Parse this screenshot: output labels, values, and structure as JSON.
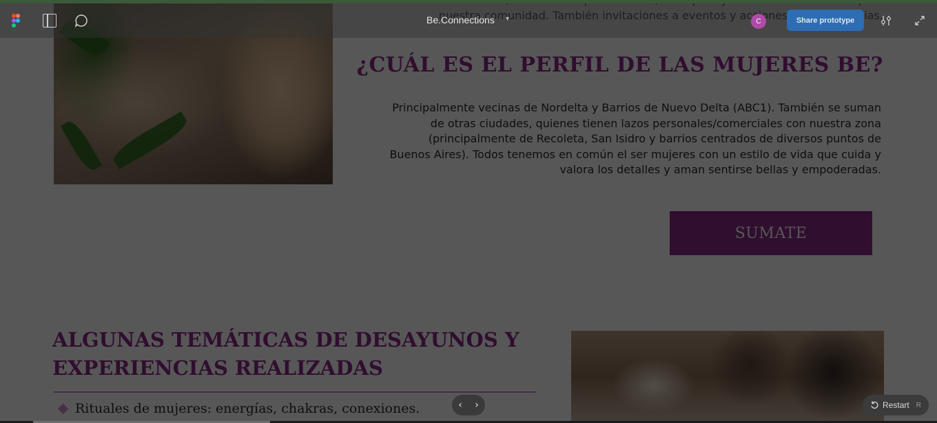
{
  "figma": {
    "file_title": "Be.Connections",
    "avatar_initial": "C",
    "share_label": "Share prototype",
    "restart_label": "Restart",
    "restart_shortcut": "R",
    "nav_prev_glyph": "‹",
    "nav_next_glyph": "›",
    "accent_color": "#3b5a39",
    "share_color": "#2d6db3",
    "avatar_color": "#b04aa8"
  },
  "content": {
    "intro_text": "Además como socia, vas a recibir promociones, obsequios y descuentos exclusivos para nuestra comunidad. También invitaciones a eventos y acciones solo para socias.",
    "perfil_title": "¿CUÁL ES EL PERFIL DE LAS MUJERES BE?",
    "perfil_text": "Principalmente vecinas de Nordelta y Barrios de Nuevo Delta (ABC1). También se suman de otras ciudades, quienes tienen lazos personales/comerciales con nuestra zona (principalmente de Recoleta, San Isidro y barrios centrados de diversos puntos de Buenos Aires). Todos tenemos en común el ser mujeres con un estilo de vida que cuida y valora los detalles y aman sentirse bellas y empoderadas.",
    "sumate_label": "SUMATE",
    "tematicas_title": "ALGUNAS TEMÁTICAS DE DESAYUNOS Y EXPERIENCIAS REALIZADAS",
    "tematicas_items": [
      "Rituales de mujeres: energías, chakras, conexiones."
    ],
    "brand_color": "#8e2a8a"
  }
}
